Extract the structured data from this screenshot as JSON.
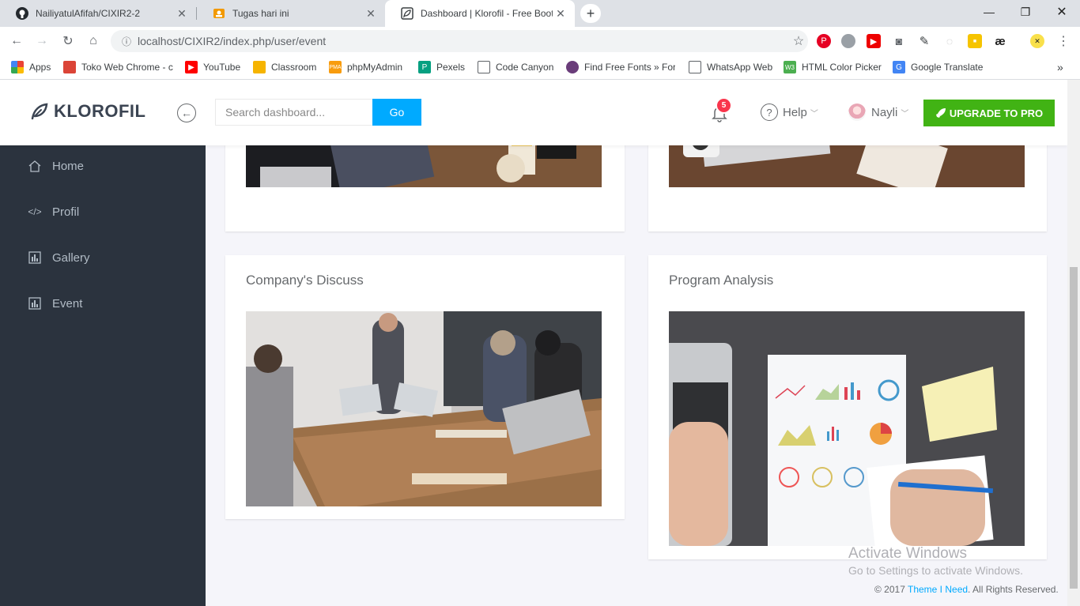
{
  "browser": {
    "tabs": [
      {
        "title": "NailiyatulAfifah/CIXIR2-2",
        "icon": "github-icon"
      },
      {
        "title": "Tugas hari ini",
        "icon": "classroom-icon"
      },
      {
        "title": "Dashboard | Klorofil - Free Bootstrap",
        "icon": "klorofil-icon"
      }
    ],
    "url": "localhost/CIXIR2/index.php/user/event",
    "bookmarks": [
      {
        "label": "Apps",
        "icon": "apps-grid-icon"
      },
      {
        "label": "Toko Web Chrome - c",
        "icon": "chrome-store-icon"
      },
      {
        "label": "YouTube",
        "icon": "youtube-icon"
      },
      {
        "label": "Classroom",
        "icon": "classroom-icon"
      },
      {
        "label": "phpMyAdmin",
        "icon": "phpmyadmin-icon"
      },
      {
        "label": "Pexels",
        "icon": "pexels-icon"
      },
      {
        "label": "Code Canyon",
        "icon": "page-icon"
      },
      {
        "label": "Find Free Fonts » For",
        "icon": "fonts-icon"
      },
      {
        "label": "WhatsApp Web",
        "icon": "page-icon"
      },
      {
        "label": "HTML Color Picker",
        "icon": "w3-icon"
      },
      {
        "label": "Google Translate",
        "icon": "translate-icon"
      }
    ],
    "more_bookmarks": "»"
  },
  "app": {
    "brand": "KLOROFIL",
    "search_placeholder": "Search dashboard...",
    "go_label": "Go",
    "notification_count": "5",
    "help_label": "Help",
    "user_name": "Nayli",
    "upgrade_label": "UPGRADE TO PRO",
    "sidebar": [
      {
        "label": "Home",
        "icon": "home-icon"
      },
      {
        "label": "Profil",
        "icon": "code-icon"
      },
      {
        "label": "Gallery",
        "icon": "chart-icon"
      },
      {
        "label": "Event",
        "icon": "chart-icon"
      }
    ],
    "panels": [
      {
        "title": "Company's Discuss"
      },
      {
        "title": "Program Analysis"
      }
    ],
    "watermark_title": "Activate Windows",
    "watermark_sub": "Go to Settings to activate Windows.",
    "footer_prefix": "© 2017 ",
    "footer_link": "Theme I Need",
    "footer_suffix": ". All Rights Reserved."
  },
  "colors": {
    "accent": "#00aaff",
    "upgrade": "#41b314",
    "sidebar_bg": "#2b333e",
    "badge": "#f9354c"
  }
}
